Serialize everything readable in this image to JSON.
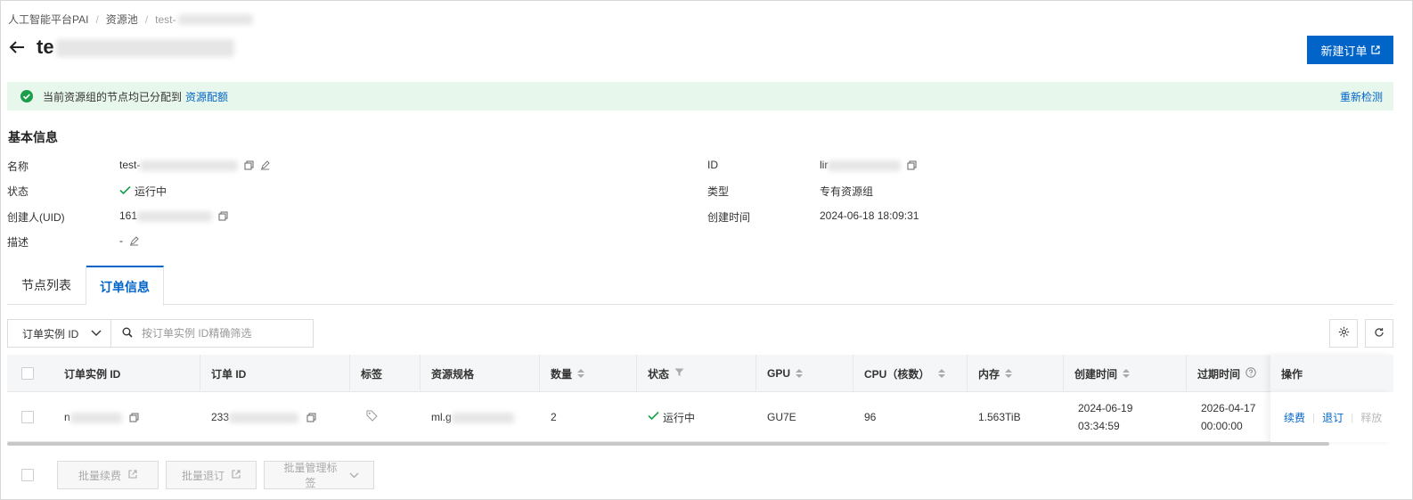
{
  "breadcrumb": {
    "items": [
      "人工智能平台PAI",
      "资源池"
    ],
    "current": "test-"
  },
  "header": {
    "title": "te",
    "new_order_label": "新建订单"
  },
  "alert": {
    "text": "当前资源组的节点均已分配到",
    "link": "资源配额",
    "action": "重新检测"
  },
  "basic_info": {
    "title": "基本信息",
    "name_label": "名称",
    "name_value": "test-",
    "status_label": "状态",
    "status_value": "运行中",
    "creator_label": "创建人(UID)",
    "creator_value": "161",
    "desc_label": "描述",
    "desc_value": "-",
    "id_label": "ID",
    "id_value": "lir",
    "type_label": "类型",
    "type_value": "专有资源组",
    "created_label": "创建时间",
    "created_value": "2024-06-18 18:09:31"
  },
  "tabs": [
    {
      "label": "节点列表"
    },
    {
      "label": "订单信息"
    }
  ],
  "filter": {
    "select_value": "订单实例 ID",
    "placeholder": "按订单实例 ID精确筛选"
  },
  "table": {
    "columns": [
      "订单实例 ID",
      "订单 ID",
      "标签",
      "资源规格",
      "数量",
      "状态",
      "GPU",
      "CPU（核数）",
      "内存",
      "创建时间",
      "过期时间",
      "操作"
    ],
    "row": {
      "instance_id": "n",
      "order_id": "233",
      "spec": "ml.g",
      "count": "2",
      "status": "运行中",
      "gpu": "GU7E",
      "cpu": "96",
      "memory": "1.563TiB",
      "created_date": "2024-06-19",
      "created_time": "03:34:59",
      "expire_date": "2026-04-17",
      "expire_time": "00:00:00",
      "ops": [
        "续费",
        "退订",
        "释放"
      ]
    }
  },
  "footer": {
    "batch_renew": "批量续费",
    "batch_unsubscribe": "批量退订",
    "batch_tags": "批量管理标签"
  },
  "colors": {
    "primary": "#0064c8",
    "success": "#1a9e4b",
    "alert_bg": "#e8f7ec"
  }
}
